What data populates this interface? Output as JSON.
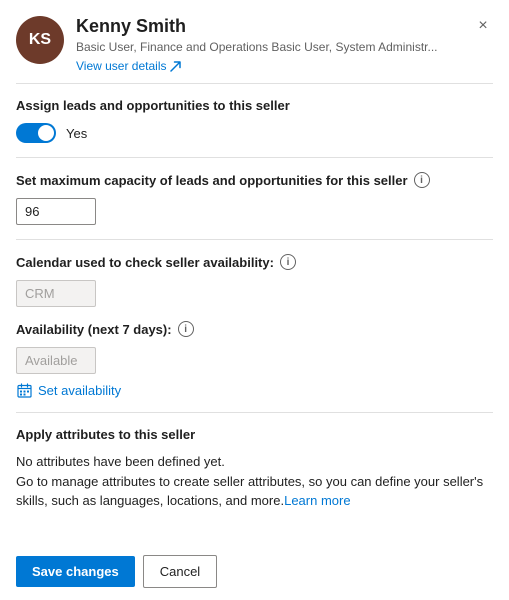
{
  "header": {
    "avatar_initials": "KS",
    "user_name": "Kenny Smith",
    "user_roles": "Basic User, Finance and Operations Basic User, System Administr...",
    "view_user_label": "View user details",
    "close_label": "×"
  },
  "sections": {
    "assign_leads": {
      "label": "Assign leads and opportunities to this seller",
      "toggle_value": true,
      "toggle_text": "Yes"
    },
    "max_capacity": {
      "label": "Set maximum capacity of leads and opportunities for this seller",
      "input_value": "96",
      "has_info": true
    },
    "calendar": {
      "label": "Calendar used to check seller availability:",
      "input_value": "CRM",
      "has_info": true
    },
    "availability": {
      "label": "Availability (next 7 days):",
      "input_value": "Available",
      "has_info": true,
      "set_availability_label": "Set availability"
    },
    "attributes": {
      "label": "Apply attributes to this seller",
      "line1": "No attributes have been defined yet.",
      "line2": "Go to manage attributes to create seller attributes, so you can define your seller's skills, such as languages, locations, and more.",
      "learn_more_label": "Learn more"
    }
  },
  "footer": {
    "save_label": "Save changes",
    "cancel_label": "Cancel"
  },
  "icons": {
    "info": "i",
    "external_link": "↗",
    "calendar": "📅",
    "close": "×"
  }
}
